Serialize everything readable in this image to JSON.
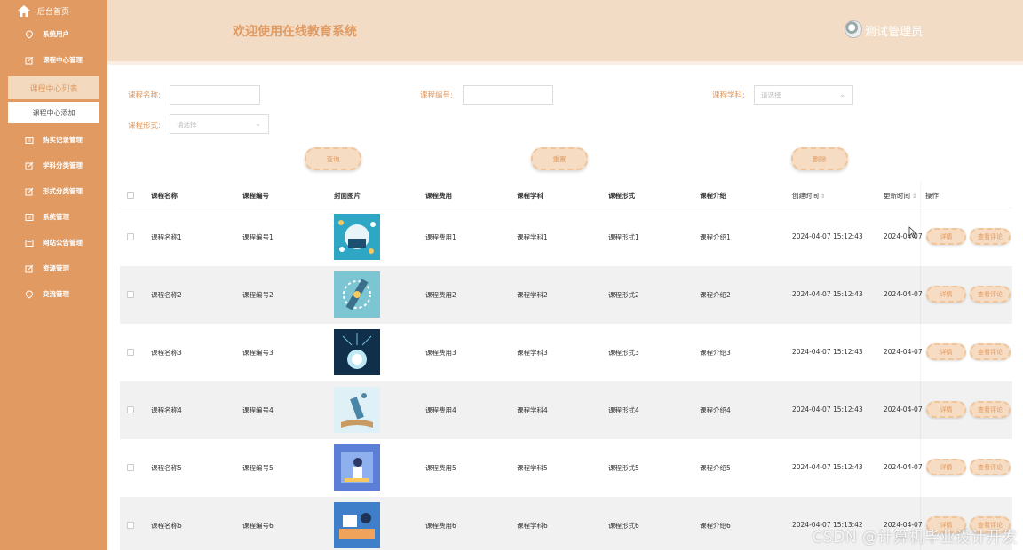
{
  "sidebar": {
    "home": "后台首页",
    "items": [
      {
        "label": "系统用户",
        "icon": "location-icon"
      },
      {
        "label": "课程中心管理",
        "icon": "edit-icon"
      }
    ],
    "sub_active": "课程中心列表",
    "sub_add": "课程中心添加",
    "items2": [
      {
        "label": "购买记录管理",
        "icon": "list-icon"
      },
      {
        "label": "学科分类管理",
        "icon": "edit-icon"
      },
      {
        "label": "形式分类管理",
        "icon": "edit-icon"
      },
      {
        "label": "系统管理",
        "icon": "list-icon"
      },
      {
        "label": "网站公告管理",
        "icon": "notice-icon"
      },
      {
        "label": "资源管理",
        "icon": "edit-icon"
      },
      {
        "label": "交流管理",
        "icon": "location-icon"
      }
    ]
  },
  "header": {
    "title": "欢迎使用在线教育系统",
    "user": "测试管理员"
  },
  "filters": {
    "name_label": "课程名称:",
    "code_label": "课程编号:",
    "subject_label": "课程学科:",
    "subject_placeholder": "请选择",
    "form_label": "课程形式:",
    "form_placeholder": "请选择"
  },
  "buttons": {
    "search": "查询",
    "reset": "重置",
    "delete": "删除"
  },
  "table": {
    "headers": [
      "课程名称",
      "课程编号",
      "封面图片",
      "课程费用",
      "课程学科",
      "课程形式",
      "课程介绍",
      "创建时间",
      "更新时间",
      "操作"
    ],
    "rows": [
      {
        "name": "课程名称1",
        "code": "课程编号1",
        "fee": "课程费用1",
        "subject": "课程学科1",
        "form": "课程形式1",
        "intro": "课程介绍1",
        "created": "2024-04-07 15:12:43",
        "updated": "2024-04-07"
      },
      {
        "name": "课程名称2",
        "code": "课程编号2",
        "fee": "课程费用2",
        "subject": "课程学科2",
        "form": "课程形式2",
        "intro": "课程介绍2",
        "created": "2024-04-07 15:12:43",
        "updated": "2024-04-07"
      },
      {
        "name": "课程名称3",
        "code": "课程编号3",
        "fee": "课程费用3",
        "subject": "课程学科3",
        "form": "课程形式3",
        "intro": "课程介绍3",
        "created": "2024-04-07 15:12:43",
        "updated": "2024-04-07"
      },
      {
        "name": "课程名称4",
        "code": "课程编号4",
        "fee": "课程费用4",
        "subject": "课程学科4",
        "form": "课程形式4",
        "intro": "课程介绍4",
        "created": "2024-04-07 15:12:43",
        "updated": "2024-04-07"
      },
      {
        "name": "课程名称5",
        "code": "课程编号5",
        "fee": "课程费用5",
        "subject": "课程学科5",
        "form": "课程形式5",
        "intro": "课程介绍5",
        "created": "2024-04-07 15:12:43",
        "updated": "2024-04-07"
      },
      {
        "name": "课程名称6",
        "code": "课程编号6",
        "fee": "课程费用6",
        "subject": "课程学科6",
        "form": "课程形式6",
        "intro": "课程介绍6",
        "created": "2024-04-07 15:13:42",
        "updated": "2024-04-07"
      }
    ],
    "detail_btn": "详情",
    "comment_btn": "查看评论"
  },
  "watermark": "CSDN @计算机毕业设计开发",
  "colors": {
    "accent": "#e09a62",
    "header_bg": "#f2dcc6",
    "button_bg": "#f6dcc2"
  }
}
